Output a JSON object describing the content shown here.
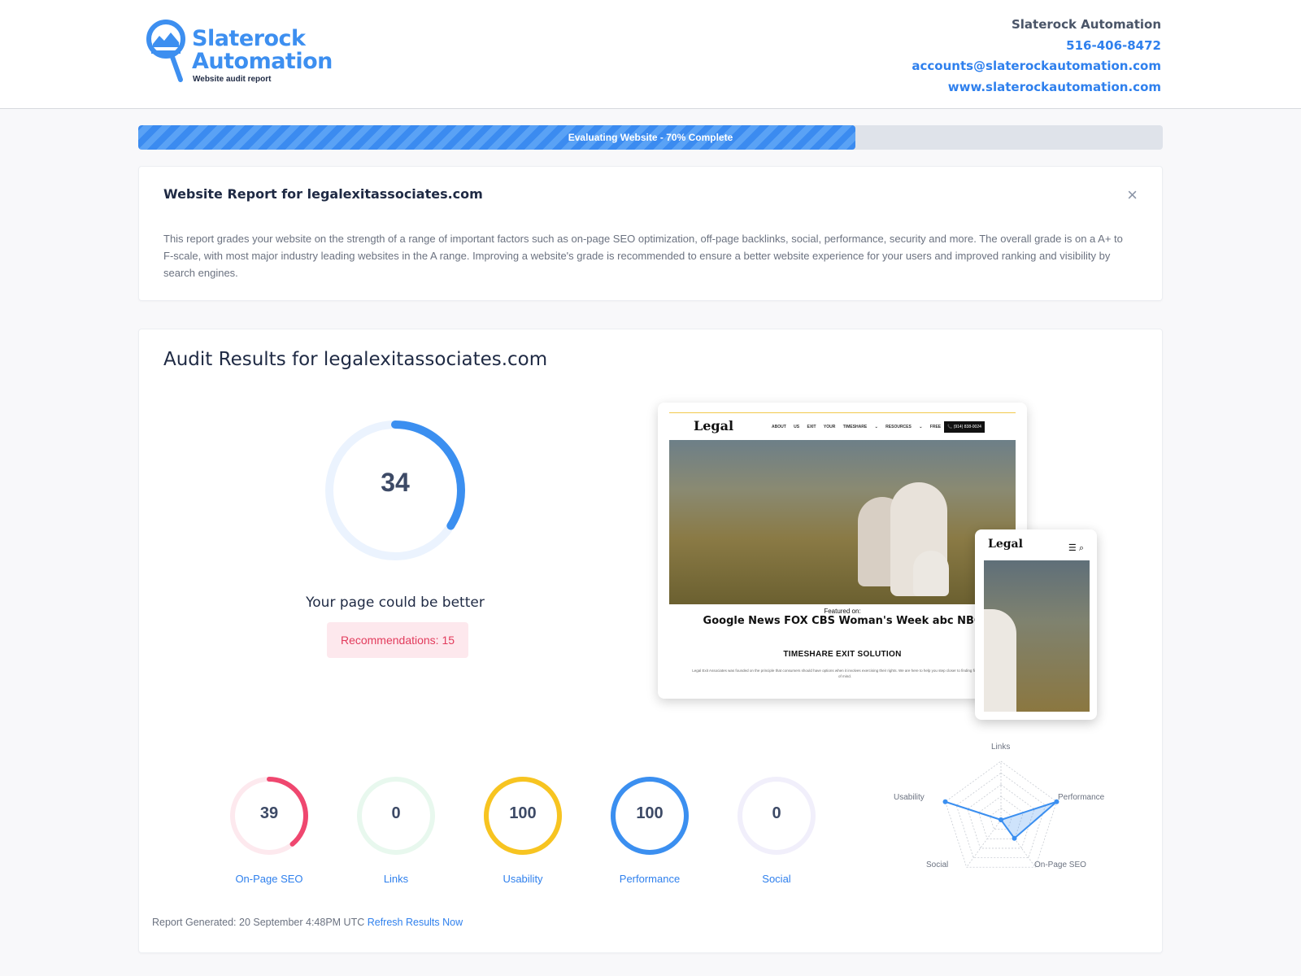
{
  "brand": {
    "name": "Slaterock\nAutomation",
    "subtitle": "Website audit report",
    "colors": {
      "primary": "#3d8ff0",
      "accent": "#2f80ed",
      "danger": "#ef476f",
      "warn": "#f7c421"
    }
  },
  "contact": {
    "company": "Slaterock Automation",
    "phone": "516-406-8472",
    "email": "accounts@slaterockautomation.com",
    "website": "www.slaterockautomation.com"
  },
  "progress": {
    "label": "Evaluating Website - 70% Complete",
    "percent": 70
  },
  "report": {
    "title": "Website Report for legalexitassociates.com",
    "description": "This report grades your website on the strength of a range of important factors such as on-page SEO optimization, off-page backlinks, social, performance, security and more. The overall grade is on a A+ to F-scale, with most major industry leading websites in the A range. Improving a website's grade is recommended to ensure a better website experience for your users and improved ranking and visibility by search engines.",
    "close_icon": "close-icon"
  },
  "audit": {
    "title": "Audit Results for legalexitassociates.com",
    "overall_score": "34",
    "overall_value": 34,
    "verdict": "Your page could be better",
    "recommendations": "Recommendations: 15",
    "preview": {
      "desktop_logo": "Legal",
      "nav_links": "ABOUT US   EXIT YOUR TIMESHARE ⌄   RESOURCES ⌄   FREE CONSULTATION",
      "phone": "📞 (914) 838-0024",
      "featured_label": "Featured on:",
      "featured_brands": "Google News FOX CBS Woman's Week abc NBC",
      "section_title": "TIMESHARE EXIT SOLUTION",
      "section_text": "Legal Exit Associates was founded on the principle that consumers should have options when it involves exercising their rights. We are here to help you step closer to finding financial peace of mind.",
      "mobile_logo": "Legal"
    },
    "scores": [
      {
        "label": "On-Page SEO",
        "display": "39",
        "value": 39,
        "color": "#ef476f",
        "track": "#fde9ee"
      },
      {
        "label": "Links",
        "display": "0",
        "value": 0,
        "color": "#22c55e",
        "track": "#e8f8ee"
      },
      {
        "label": "Usability",
        "display": "100",
        "value": 100,
        "color": "#f7c421",
        "track": "#fdf5d6"
      },
      {
        "label": "Performance",
        "display": "100",
        "value": 100,
        "color": "#3b8ff0",
        "track": "#e3efff"
      },
      {
        "label": "Social",
        "display": "0",
        "value": 0,
        "color": "#8b5cf6",
        "track": "#f1effb"
      }
    ],
    "radar": {
      "axes": [
        "Links",
        "Performance",
        "On-Page SEO",
        "Social",
        "Usability"
      ],
      "values": [
        0,
        100,
        39,
        0,
        100
      ]
    },
    "footer_prefix": "Report Generated: 20 September 4:48PM UTC",
    "refresh_link": "Refresh Results Now"
  }
}
